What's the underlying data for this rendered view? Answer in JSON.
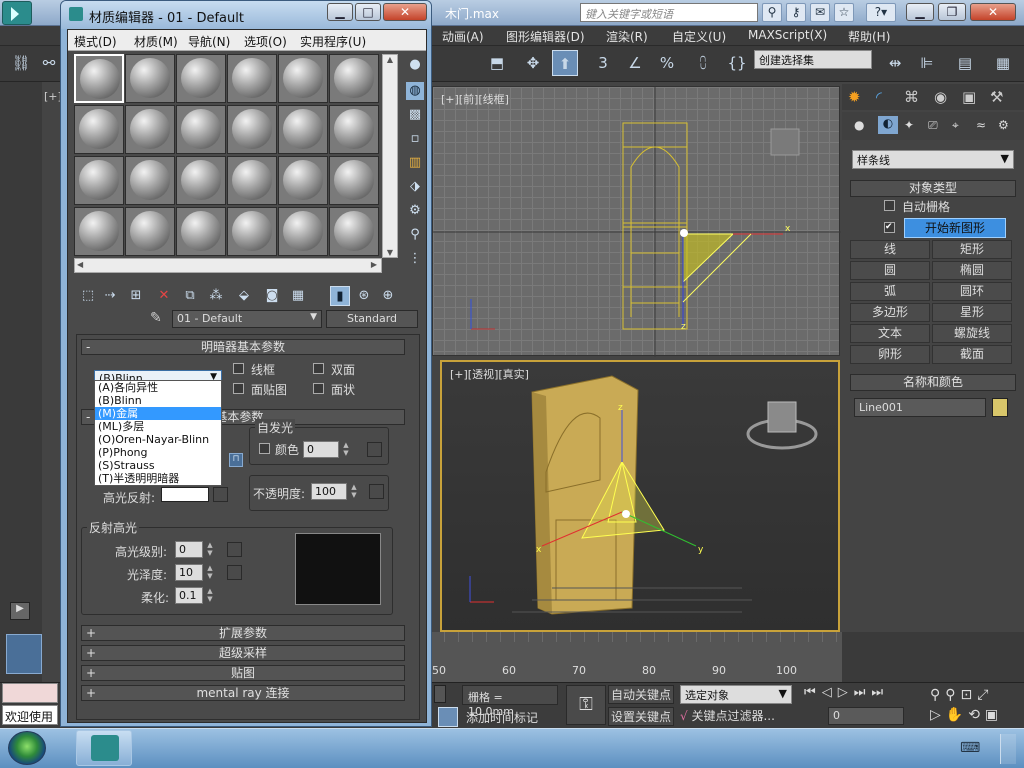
{
  "app": {
    "file_title": "木门.max",
    "search_placeholder": "键入关键字或短语"
  },
  "main_menu": [
    "动画(A)",
    "图形编辑器(D)",
    "渲染(R)",
    "自定义(U)",
    "MAXScript(X)",
    "帮助(H)"
  ],
  "toolbar": {
    "selection_set": "创建选择集"
  },
  "viewports": {
    "top_label": "[+][前][线框]",
    "persp_label": "[+][透视][真实]",
    "left_label": "[+]"
  },
  "command_panel": {
    "category": "样条线",
    "object_type_title": "对象类型",
    "auto_grid": "自动栅格",
    "start_new_shape": "开始新图形",
    "start_new_shape_checked": true,
    "buttons": [
      "线",
      "矩形",
      "圆",
      "椭圆",
      "弧",
      "圆环",
      "多边形",
      "星形",
      "文本",
      "螺旋线",
      "卵形",
      "截面"
    ],
    "name_color_title": "名称和颜色",
    "object_name": "Line001",
    "object_color": "#d8c66a"
  },
  "timeline": {
    "ticks": [
      "50",
      "60",
      "70",
      "80",
      "90",
      "100"
    ]
  },
  "status": {
    "grid": "栅格 = 10.0mm",
    "auto_key": "自动关键点",
    "set_key": "设置关键点",
    "selected_object": "选定对象",
    "key_filters": "关键点过滤器...",
    "add_time_tag": "添加时间标记",
    "frame": "0",
    "welcome": "欢迎使用"
  },
  "material_editor": {
    "title": "材质编辑器 - 01 - Default",
    "menu": [
      "模式(D)",
      "材质(M)",
      "导航(N)",
      "选项(O)",
      "实用程序(U)"
    ],
    "material_name": "01 - Default",
    "material_type": "Standard",
    "shader_basic_title": "明暗器基本参数",
    "shader_selected": "(B)Blinn",
    "shader_options": [
      "(A)各向异性",
      "(B)Blinn",
      "(M)金属",
      "(ML)多层",
      "(O)Oren-Nayar-Blinn",
      "(P)Phong",
      "(S)Strauss",
      "(T)半透明明暗器"
    ],
    "shader_highlighted": "(M)金属",
    "wire": "线框",
    "two_sided": "双面",
    "face_map": "面贴图",
    "faceted": "面状",
    "blinn_basic_title": "n 基本参数",
    "self_illum": "自发光",
    "color": "颜色",
    "self_illum_value": "0",
    "specular_label": "高光反射:",
    "opacity_label": "不透明度:",
    "opacity_value": "100",
    "spec_hl_title": "反射高光",
    "spec_level_label": "高光级别:",
    "spec_level": "0",
    "gloss_label": "光泽度:",
    "gloss": "10",
    "soften_label": "柔化:",
    "soften": "0.1",
    "rollouts": [
      "扩展参数",
      "超级采样",
      "贴图",
      "mental ray 连接"
    ]
  }
}
